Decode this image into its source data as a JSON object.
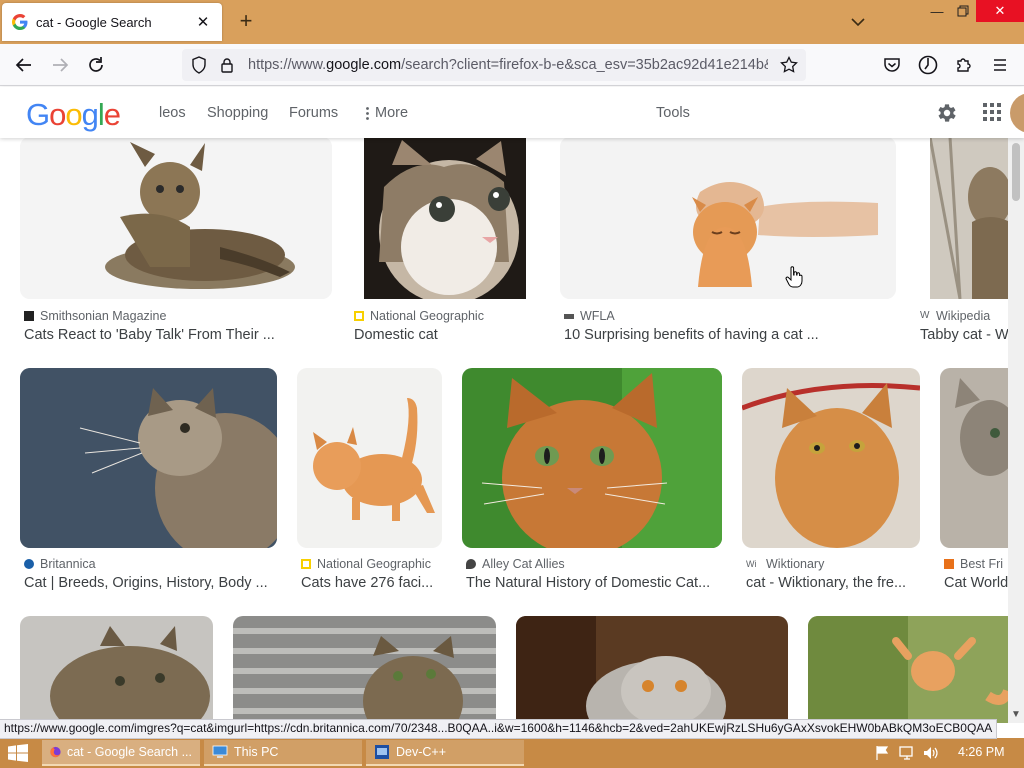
{
  "browser": {
    "tab_title": "cat - Google Search",
    "url_prefix": "https://www.",
    "url_domain": "google.com",
    "url_rest": "/search?client=firefox-b-e&sca_esv=35b2ac92d41e214b&sca_",
    "status_url": "https://www.google.com/imgres?q=cat&imgurl=https://cdn.britannica.com/70/2348...B0QAA..i&w=1600&h=1146&hcb=2&ved=2ahUKEwjRzLSHu6yGAxXsvokEHW0bABkQM3oECB0QAA"
  },
  "google": {
    "logo_letters": [
      {
        "ch": "G",
        "color": "#4285f4"
      },
      {
        "ch": "o",
        "color": "#ea4335"
      },
      {
        "ch": "o",
        "color": "#fbbc05"
      },
      {
        "ch": "g",
        "color": "#4285f4"
      },
      {
        "ch": "l",
        "color": "#34a853"
      },
      {
        "ch": "e",
        "color": "#ea4335"
      }
    ],
    "nav": {
      "videos": "leos",
      "shopping": "Shopping",
      "forums": "Forums",
      "more": "More"
    },
    "tools": "Tools"
  },
  "results": [
    {
      "source": "Smithsonian Magazine",
      "caption": "Cats React to 'Baby Talk' From Their ...",
      "icon_color": "#222222"
    },
    {
      "source": "National Geographic",
      "caption": "Domestic cat",
      "icon_color": "#f8d000"
    },
    {
      "source": "WFLA",
      "caption": "10 Surprising benefits of having a cat ...",
      "icon_color": "#555555"
    },
    {
      "source": "Wikipedia",
      "caption": "Tabby cat - W",
      "icon_color": "#333333"
    },
    {
      "source": "Britannica",
      "caption": "Cat | Breeds, Origins, History, Body ...",
      "icon_color": "#1a5fa8"
    },
    {
      "source": "National Geographic",
      "caption": "Cats have 276 faci...",
      "icon_color": "#f8d000"
    },
    {
      "source": "Alley Cat Allies",
      "caption": "The Natural History of Domestic Cat...",
      "icon_color": "#444444"
    },
    {
      "source": "Wiktionary",
      "caption": "cat - Wiktionary, the fre...",
      "icon_color": "#333333"
    },
    {
      "source": "Best Fri",
      "caption": "Cat World",
      "icon_color": "#e8711a"
    }
  ],
  "taskbar": {
    "items": [
      "cat - Google Search ...",
      "This PC",
      "Dev-C++"
    ],
    "clock": "4:26 PM"
  }
}
